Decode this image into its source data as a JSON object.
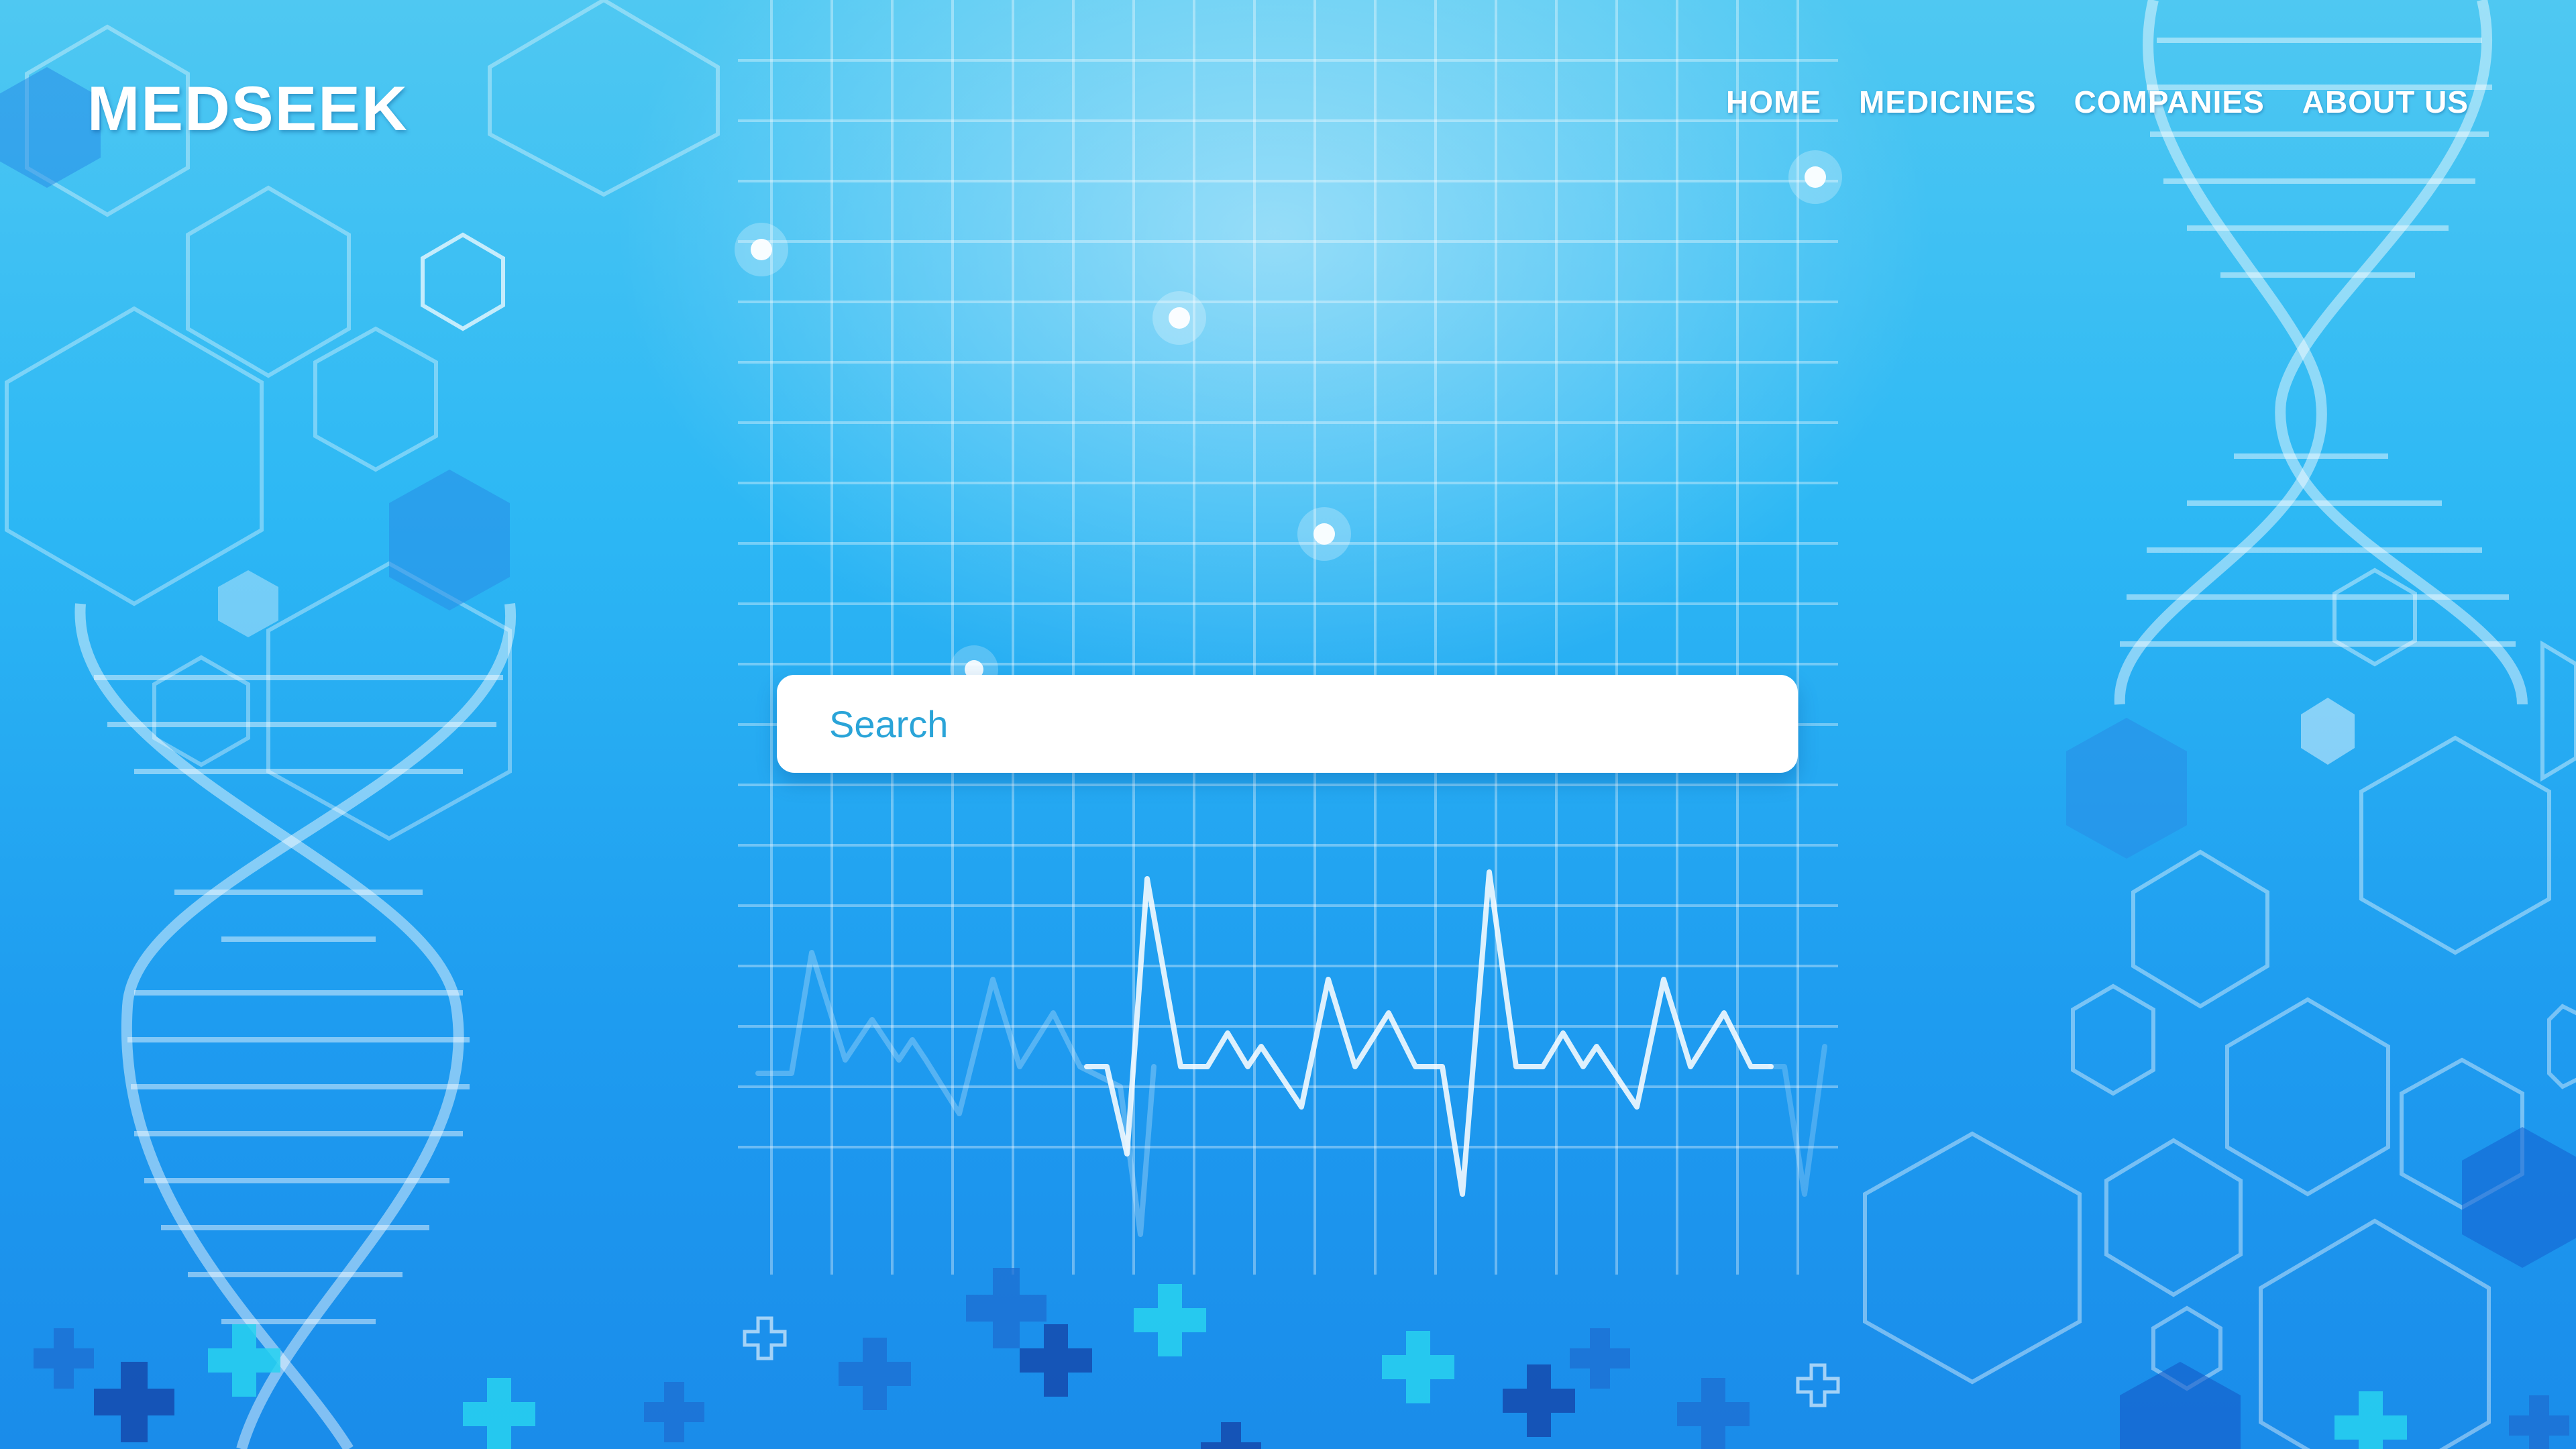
{
  "app": {
    "logo": "MEDSEEK"
  },
  "nav": {
    "items": [
      {
        "label": "HOME"
      },
      {
        "label": "MEDICINES"
      },
      {
        "label": "COMPANIES"
      },
      {
        "label": "ABOUT US"
      }
    ]
  },
  "search": {
    "placeholder": "Search",
    "value": ""
  },
  "theme": {
    "background": "#2db8f4",
    "text": "#ffffff",
    "placeholder": "#2aa4d8"
  }
}
